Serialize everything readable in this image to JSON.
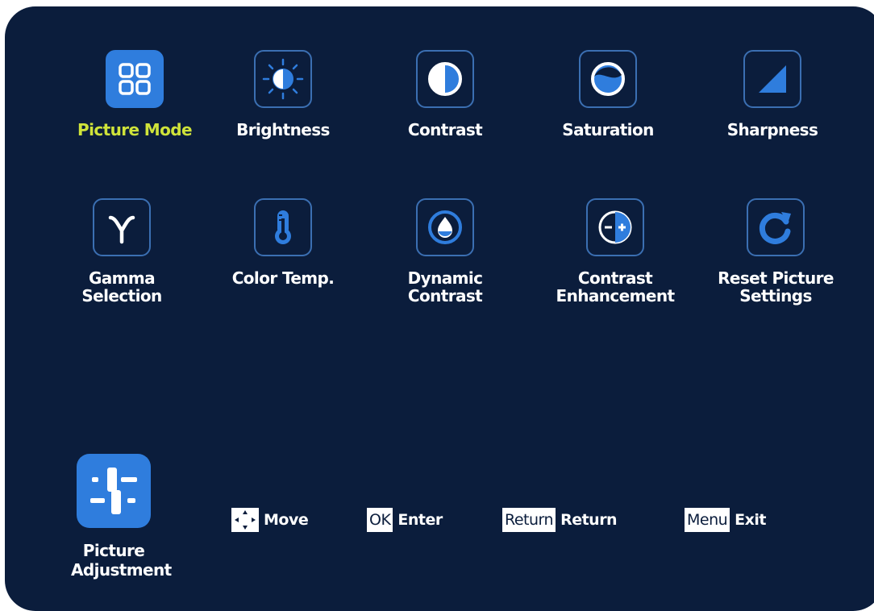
{
  "menu": {
    "items": [
      {
        "label_lines": [
          "Picture Mode"
        ],
        "icon": "grid-icon",
        "selected": true
      },
      {
        "label_lines": [
          "Brightness"
        ],
        "icon": "sun-icon"
      },
      {
        "label_lines": [
          "Contrast"
        ],
        "icon": "half-circle-icon"
      },
      {
        "label_lines": [
          "Saturation"
        ],
        "icon": "saturation-icon"
      },
      {
        "label_lines": [
          "Sharpness"
        ],
        "icon": "triangle-icon"
      },
      {
        "label_lines": [
          "Gamma",
          "Selection"
        ],
        "icon": "gamma-icon"
      },
      {
        "label_lines": [
          "Color Temp."
        ],
        "icon": "thermometer-icon"
      },
      {
        "label_lines": [
          "Dynamic",
          "Contrast"
        ],
        "icon": "drop-icon"
      },
      {
        "label_lines": [
          "Contrast",
          "Enhancement"
        ],
        "icon": "minus-plus-icon"
      },
      {
        "label_lines": [
          "Reset Picture",
          "Settings"
        ],
        "icon": "reset-icon"
      }
    ]
  },
  "category": {
    "label_lines": [
      "Picture",
      "Adjustment"
    ],
    "icon": "sliders-icon"
  },
  "hints": [
    {
      "key": "",
      "key_icon": "dpad-icon",
      "action": "Move"
    },
    {
      "key": "OK",
      "action": "Enter"
    },
    {
      "key": "Return",
      "action": "Return"
    },
    {
      "key": "Menu",
      "action": "Exit"
    }
  ],
  "colors": {
    "background": "#0b1d3c",
    "accent": "#2f7ddd",
    "selected_text": "#cfe33a",
    "text": "#ffffff"
  }
}
